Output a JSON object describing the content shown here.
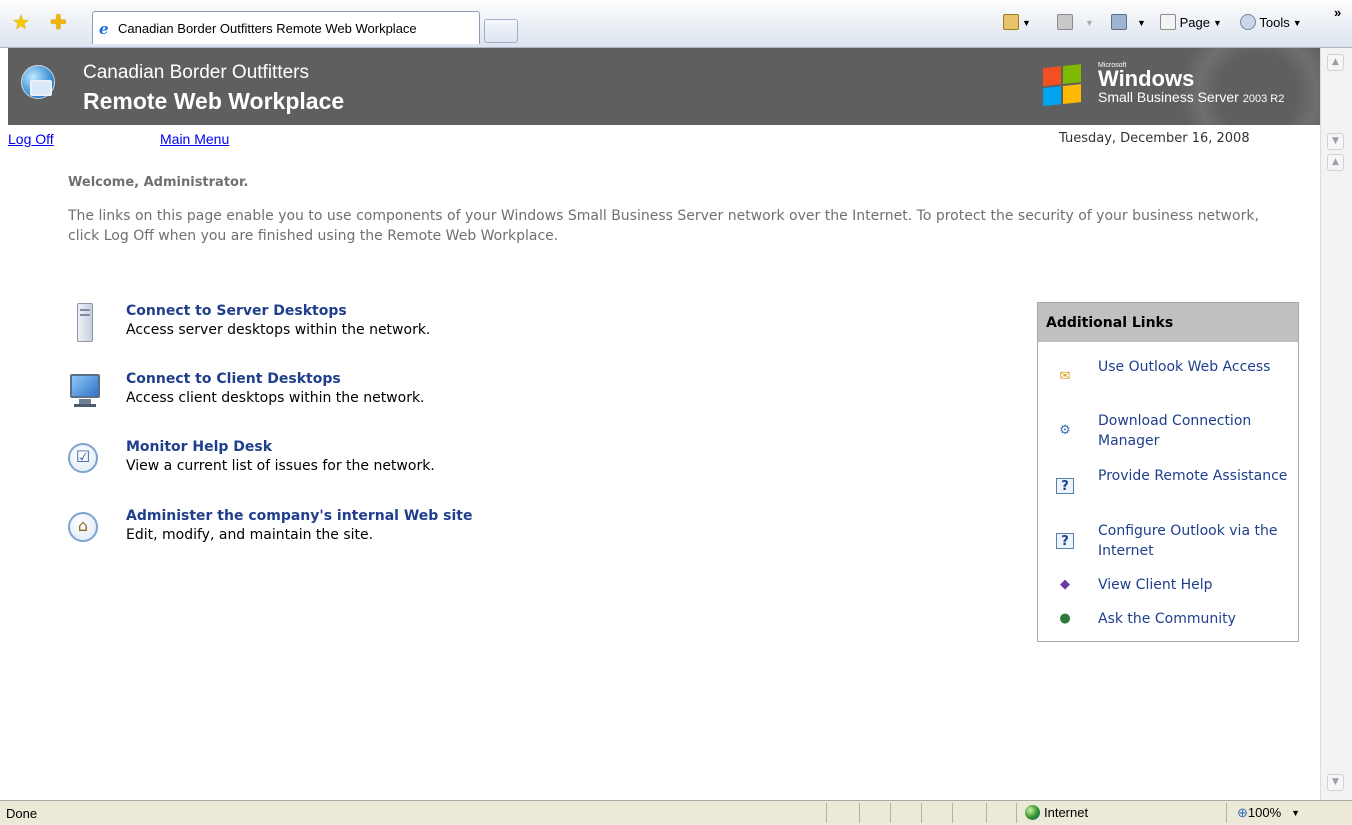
{
  "browser": {
    "tab_title": "Canadian Border Outfitters Remote Web Workplace",
    "toolbar": {
      "page_label": "Page",
      "tools_label": "Tools"
    }
  },
  "header": {
    "company": "Canadian Border Outfitters",
    "app_title": "Remote Web Workplace",
    "brand_small": "Microsoft",
    "brand_windows": "Windows",
    "brand_product": "Small Business Server",
    "brand_version": "2003 R2"
  },
  "nav": {
    "log_off": "Log Off",
    "main_menu": "Main Menu",
    "date": "Tuesday, December 16, 2008"
  },
  "welcome": "Welcome, Administrator.",
  "intro": "The links on this page enable you to use components of your Windows Small Business Server network over the Internet. To protect the security of your business network, click Log Off when you are finished using the Remote Web Workplace.",
  "tasks": [
    {
      "title": "Connect to Server Desktops",
      "desc": "Access server desktops within the network.",
      "icon": "server-icon"
    },
    {
      "title": "Connect to Client Desktops",
      "desc": "Access client desktops within the network.",
      "icon": "monitor-icon"
    },
    {
      "title": "Monitor Help Desk",
      "desc": "View a current list of issues for the network.",
      "icon": "checkbox-icon"
    },
    {
      "title": "Administer the company's internal Web site",
      "desc": "Edit, modify, and maintain the site.",
      "icon": "home-icon"
    }
  ],
  "additional_links": {
    "title": "Additional Links",
    "items": [
      {
        "label": "Use Outlook Web Access",
        "icon": "envelope-icon"
      },
      {
        "label": "Download Connection Manager",
        "icon": "connection-icon"
      },
      {
        "label": "Provide Remote Assistance",
        "icon": "help-icon"
      },
      {
        "label": "Configure Outlook via the Internet",
        "icon": "help-icon"
      },
      {
        "label": "View Client Help",
        "icon": "book-icon"
      },
      {
        "label": "Ask the Community",
        "icon": "community-icon"
      }
    ]
  },
  "status_bar": {
    "status": "Done",
    "zone": "Internet",
    "zoom": "100%"
  },
  "colors": {
    "header_bg": "#5f5f5f",
    "link_blue": "#1f3e8c",
    "box_header": "#c0c0c0",
    "intro_text": "#707070"
  }
}
